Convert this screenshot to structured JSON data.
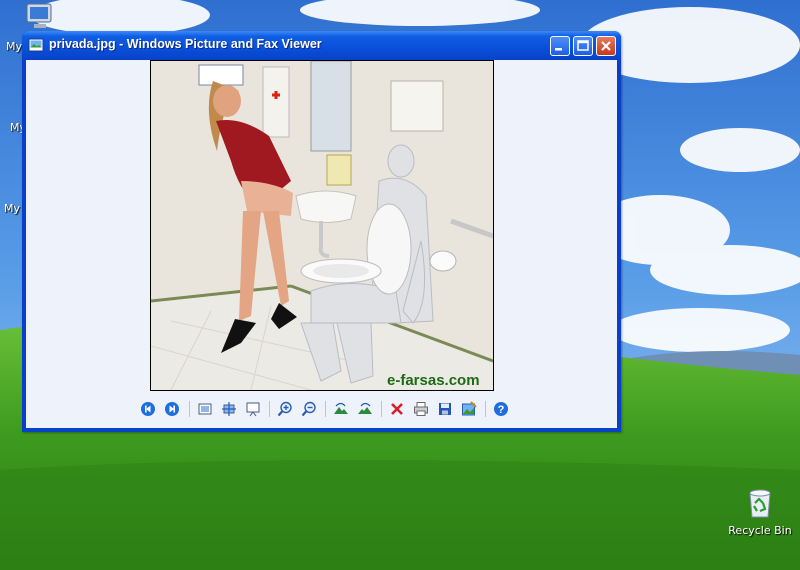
{
  "window": {
    "title": "privada.jpg - Windows Picture and Fax Viewer"
  },
  "desktop": {
    "icons": [
      {
        "label": "My"
      },
      {
        "label": "My"
      },
      {
        "label": "My"
      },
      {
        "label": "Recycle Bin"
      }
    ]
  },
  "photo": {
    "watermark": "e-farsas.com"
  },
  "toolbar": {
    "buttons": [
      {
        "name": "previous-image-icon"
      },
      {
        "name": "next-image-icon"
      },
      {
        "name": "best-fit-icon"
      },
      {
        "name": "actual-size-icon"
      },
      {
        "name": "slideshow-icon"
      },
      {
        "name": "zoom-in-icon"
      },
      {
        "name": "zoom-out-icon"
      },
      {
        "name": "rotate-clockwise-icon"
      },
      {
        "name": "rotate-counterclockwise-icon"
      },
      {
        "name": "delete-icon"
      },
      {
        "name": "print-icon"
      },
      {
        "name": "save-icon"
      },
      {
        "name": "edit-icon"
      },
      {
        "name": "help-icon"
      }
    ]
  },
  "colors": {
    "titlebar": "#0a4fd9",
    "client": "#eef3fb",
    "sky": "#4b8fd8",
    "grass": "#3a9a1e"
  }
}
